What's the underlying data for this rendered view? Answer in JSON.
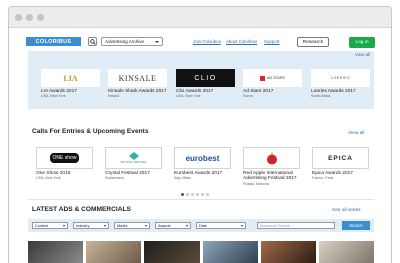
{
  "header": {
    "logo": "COLORIBUS",
    "search_select": "Advertising Archive",
    "nav": [
      "Join Coloribus",
      "About Coloribus",
      "Support"
    ],
    "research": "Research",
    "login": "Log in"
  },
  "featured": {
    "view_all": "View all",
    "items": [
      {
        "title": "LIA Awards 2017",
        "sub": "USA, New York",
        "logo": "LIA"
      },
      {
        "title": "Kinsale Shark Awards 2017",
        "sub": "Ireland",
        "logo": "KINSALE"
      },
      {
        "title": "Clio Awards 2017",
        "sub": "USA, New York",
        "logo": "CLIO"
      },
      {
        "title": "Ad Stars 2017",
        "sub": "Korea",
        "logo": "AD STARS"
      },
      {
        "title": "Loeries Awards 2017",
        "sub": "South Africa",
        "logo": "LOERIES"
      }
    ]
  },
  "events": {
    "title": "Calls For Entries & Upcoming Events",
    "view_all": "View all",
    "items": [
      {
        "title": "One Show 2018",
        "sub": "USA, New York",
        "logo": "ONE show"
      },
      {
        "title": "Crystal Festival 2017",
        "sub": "Switzerland",
        "logo": "CRYSTAL FESTIVAL"
      },
      {
        "title": "Eurobest Awards 2017",
        "sub": "Italy, Milan",
        "logo": "eurobest"
      },
      {
        "title": "Red Apple International Advertising Festival 2017",
        "sub": "Russia, Moscow",
        "logo": "RED APPLE"
      },
      {
        "title": "Epica Awards 2017",
        "sub": "France, Paris",
        "logo": "EPICA"
      }
    ]
  },
  "latest": {
    "title": "LATEST ADS & COMMERCIALS",
    "view_all": "See all works",
    "filters": [
      {
        "label": "",
        "value": "Contest"
      },
      {
        "label": "",
        "value": "Industry"
      },
      {
        "label": "",
        "value": "Media"
      },
      {
        "label": "",
        "value": "Awards"
      },
      {
        "label": "",
        "value": "Date"
      }
    ],
    "search_placeholder": "Advanced Search",
    "search_button": "Search"
  },
  "colors": {
    "accent": "#3b8fd0",
    "login": "#19a84c",
    "panel": "#e0ecf6",
    "link": "#2f6fb5"
  }
}
